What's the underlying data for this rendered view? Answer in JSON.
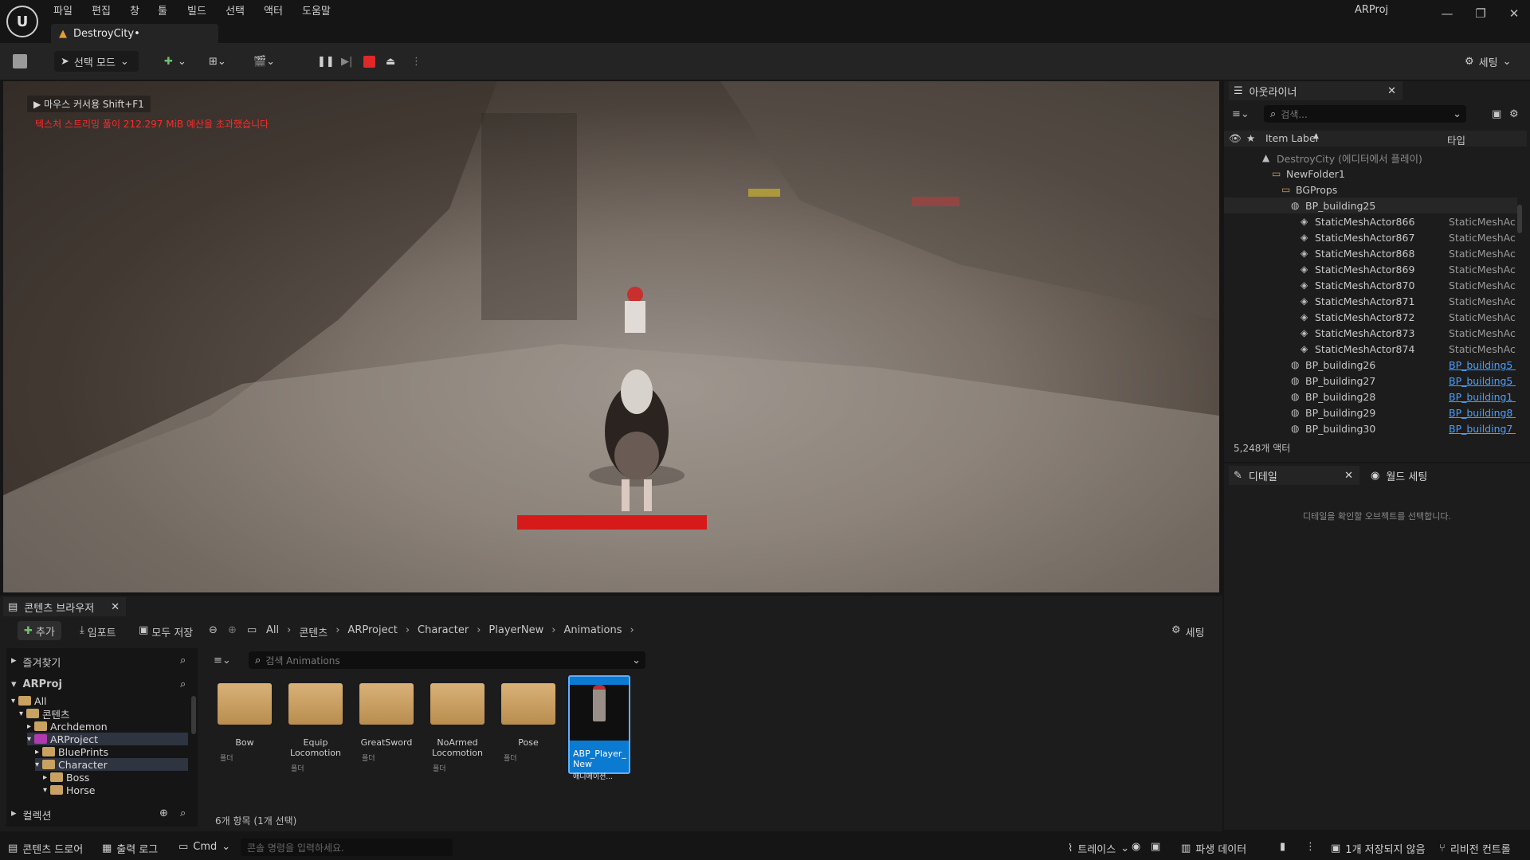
{
  "menu": [
    "파일",
    "편집",
    "창",
    "툴",
    "빌드",
    "선택",
    "액터",
    "도움말"
  ],
  "document_tab": "DestroyCity•",
  "project_name": "ARProj",
  "toolbar": {
    "mode_label": "선택 모드",
    "settings_label": "세팅"
  },
  "viewport": {
    "hint": "마우스 커서용 Shift+F1",
    "warning": "텍스처 스트리밍 풀이 212.297 MiB 예산을 초과했습니다"
  },
  "outliner": {
    "tab_label": "아웃라이너",
    "search_placeholder": "검색...",
    "col_label": "Item Label",
    "col_type": "타입",
    "rows": [
      {
        "label": "DestroyCity (에디터에서 플레이)",
        "type": "",
        "indent": 0,
        "kind": "world"
      },
      {
        "label": "NewFolder1",
        "type": "",
        "indent": 1,
        "kind": "folder"
      },
      {
        "label": "BGProps",
        "type": "",
        "indent": 2,
        "kind": "folder"
      },
      {
        "label": "BP_building25",
        "type": "",
        "indent": 3,
        "kind": "bp"
      },
      {
        "label": "StaticMeshActor866",
        "type": "StaticMeshAct",
        "indent": 4,
        "kind": "mesh"
      },
      {
        "label": "StaticMeshActor867",
        "type": "StaticMeshAct",
        "indent": 4,
        "kind": "mesh"
      },
      {
        "label": "StaticMeshActor868",
        "type": "StaticMeshAct",
        "indent": 4,
        "kind": "mesh"
      },
      {
        "label": "StaticMeshActor869",
        "type": "StaticMeshAct",
        "indent": 4,
        "kind": "mesh"
      },
      {
        "label": "StaticMeshActor870",
        "type": "StaticMeshAct",
        "indent": 4,
        "kind": "mesh"
      },
      {
        "label": "StaticMeshActor871",
        "type": "StaticMeshAct",
        "indent": 4,
        "kind": "mesh"
      },
      {
        "label": "StaticMeshActor872",
        "type": "StaticMeshAct",
        "indent": 4,
        "kind": "mesh"
      },
      {
        "label": "StaticMeshActor873",
        "type": "StaticMeshAct",
        "indent": 4,
        "kind": "mesh"
      },
      {
        "label": "StaticMeshActor874",
        "type": "StaticMeshAct",
        "indent": 4,
        "kind": "mesh"
      },
      {
        "label": "BP_building26",
        "type": "BP_building5 |",
        "indent": 3,
        "kind": "bp",
        "link": true
      },
      {
        "label": "BP_building27",
        "type": "BP_building5 |",
        "indent": 3,
        "kind": "bp",
        "link": true
      },
      {
        "label": "BP_building28",
        "type": "BP_building1 |",
        "indent": 3,
        "kind": "bp",
        "link": true
      },
      {
        "label": "BP_building29",
        "type": "BP_building8 |",
        "indent": 3,
        "kind": "bp",
        "link": true
      },
      {
        "label": "BP_building30",
        "type": "BP_building7 |",
        "indent": 3,
        "kind": "bp",
        "link": true
      }
    ],
    "actor_count": "5,248개 액터"
  },
  "details": {
    "tab_label": "디테일",
    "world_tab_label": "월드 세팅",
    "empty_message": "디테일을 확인할 오브젝트를 선택합니다."
  },
  "content_browser": {
    "tab_label": "콘텐츠 브라우저",
    "add_label": "추가",
    "import_label": "임포트",
    "save_all_label": "모두 저장",
    "settings_label": "세팅",
    "breadcrumb": [
      "All",
      "콘텐츠",
      "ARProject",
      "Character",
      "PlayerNew",
      "Animations"
    ],
    "favorites_label": "즐겨찾기",
    "root_label": "ARProj",
    "search_placeholder": "검색 Animations",
    "tree": [
      {
        "label": "All",
        "indent": 0
      },
      {
        "label": "콘텐츠",
        "indent": 1
      },
      {
        "label": "Archdemon",
        "indent": 2
      },
      {
        "label": "ARProject",
        "indent": 2
      },
      {
        "label": "BluePrints",
        "indent": 3
      },
      {
        "label": "Character",
        "indent": 3
      },
      {
        "label": "Boss",
        "indent": 4
      },
      {
        "label": "Horse",
        "indent": 4
      }
    ],
    "assets": [
      {
        "name": "Bow",
        "sub": "폴더"
      },
      {
        "name": "Equip Locomotion",
        "sub": "폴더"
      },
      {
        "name": "GreatSword",
        "sub": "폴더"
      },
      {
        "name": "NoArmed Locomotion",
        "sub": "폴더"
      },
      {
        "name": "Pose",
        "sub": "폴더"
      },
      {
        "name": "ABP_Player_ New",
        "sub": "애니메이션..."
      }
    ],
    "collections_label": "컬렉션",
    "item_count": "6개 항목 (1개 선택)"
  },
  "status_bar": {
    "drawer": "콘텐츠 드로어",
    "output_log": "출력 로그",
    "cmd": "Cmd",
    "console_placeholder": "콘솔 명령을 입력하세요.",
    "trace": "트레이스",
    "derived_data": "파생 데이터",
    "unsaved": "1개 저장되지 않음",
    "revision": "리비전 컨트롤"
  },
  "colors": {
    "accent": "#0b7ad1",
    "healthbar": "#d61a1a",
    "warning_text": "#ff2a2a"
  }
}
